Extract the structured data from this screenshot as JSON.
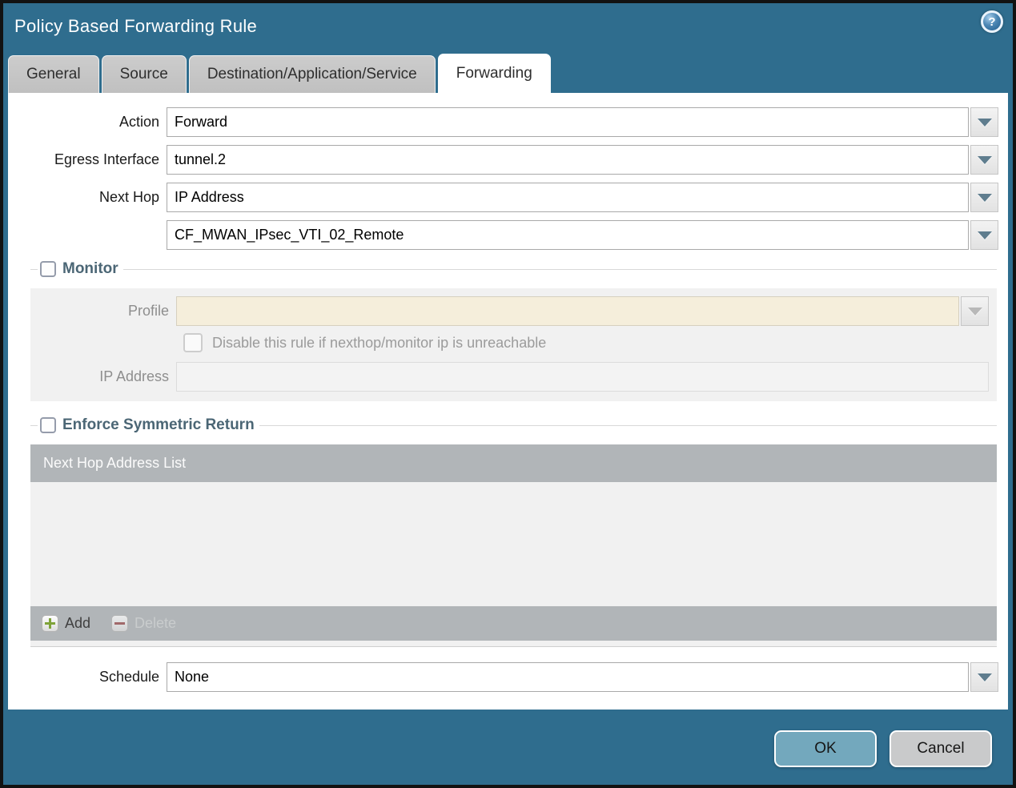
{
  "dialog": {
    "title": "Policy Based Forwarding Rule",
    "help_glyph": "?"
  },
  "tabs": [
    {
      "label": "General",
      "active": false
    },
    {
      "label": "Source",
      "active": false
    },
    {
      "label": "Destination/Application/Service",
      "active": false
    },
    {
      "label": "Forwarding",
      "active": true
    }
  ],
  "form": {
    "action": {
      "label": "Action",
      "value": "Forward"
    },
    "egress_interface": {
      "label": "Egress Interface",
      "value": "tunnel.2"
    },
    "next_hop": {
      "label": "Next Hop",
      "value": "IP Address"
    },
    "next_hop_address": {
      "value": "CF_MWAN_IPsec_VTI_02_Remote"
    },
    "schedule": {
      "label": "Schedule",
      "value": "None"
    }
  },
  "monitor": {
    "legend": "Monitor",
    "checked": false,
    "profile": {
      "label": "Profile",
      "value": ""
    },
    "disable_rule": {
      "label": "Disable this rule if nexthop/monitor ip is unreachable",
      "checked": false
    },
    "ip_address": {
      "label": "IP Address",
      "value": ""
    }
  },
  "symmetric_return": {
    "legend": "Enforce Symmetric Return",
    "checked": false,
    "table": {
      "header": "Next Hop Address List",
      "rows": [],
      "add_label": "Add",
      "delete_label": "Delete"
    }
  },
  "footer": {
    "ok_label": "OK",
    "cancel_label": "Cancel"
  },
  "colors": {
    "chrome_teal": "#2f6d8e",
    "ok_button": "#73a8bd",
    "cancel_button": "#c9cacb",
    "add_plus_green": "#7fa33a",
    "delete_minus_red": "#9c5050",
    "legend_slate": "#4b6675",
    "table_gray": "#b1b5b8",
    "profile_beige": "#f5eedb"
  }
}
